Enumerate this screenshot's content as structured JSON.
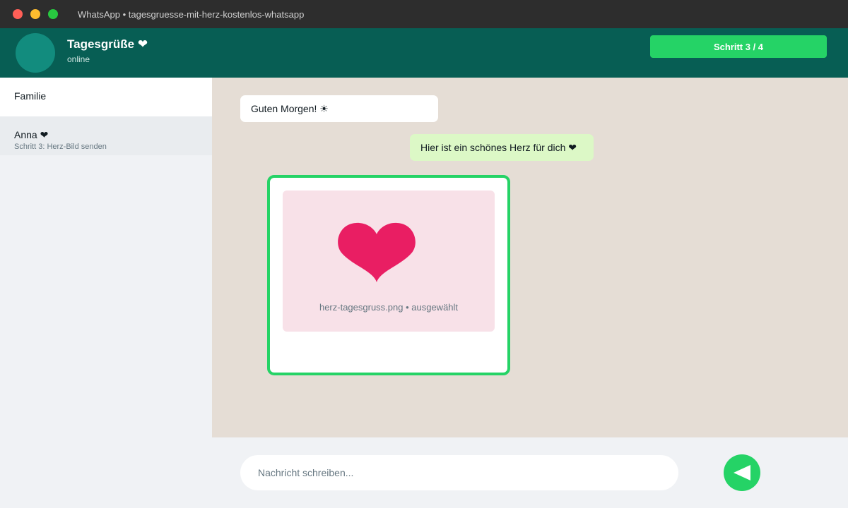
{
  "window": {
    "title": "WhatsApp • tagesgruesse-mit-herz-kostenlos-whatsapp"
  },
  "header": {
    "chat_name": "Tagesgrüße ❤",
    "status": "online",
    "step_label": "Schritt 3 / 4"
  },
  "sidebar": {
    "items": [
      {
        "name": "Familie"
      },
      {
        "name": "Anna ❤",
        "subtitle": "Schritt 3: Herz-Bild senden"
      }
    ]
  },
  "messages": [
    {
      "direction": "incoming",
      "text": "Guten Morgen! ☀"
    },
    {
      "direction": "outgoing",
      "text": "Hier ist ein schönes Herz für dich ❤"
    }
  ],
  "image_attachment": {
    "caption": "herz-tagesgruss.png • ausgewählt",
    "heart_color": "#e91e63",
    "preview_background": "#f8e1e8",
    "selected_border_color": "#25d366",
    "icon": "heart-icon"
  },
  "composer": {
    "placeholder": "Nachricht schreiben...",
    "value": "",
    "send_icon": "send-icon"
  },
  "colors": {
    "titlebar": "#2d2d2d",
    "header": "#075e54",
    "accent": "#25d366",
    "chat_background": "#e5ddd5",
    "outgoing_bubble": "#dcf8c6"
  }
}
